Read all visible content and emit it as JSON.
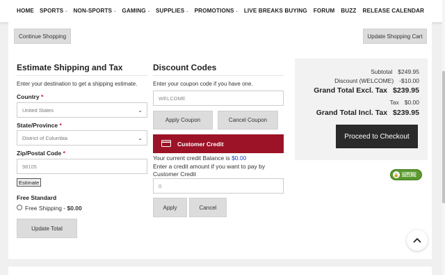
{
  "nav": {
    "left": [
      {
        "label": "HOME",
        "caret": false
      },
      {
        "label": "SPORTS",
        "caret": true
      },
      {
        "label": "NON-SPORTS",
        "caret": true
      },
      {
        "label": "GAMING",
        "caret": true
      },
      {
        "label": "SUPPLIES",
        "caret": true
      },
      {
        "label": "PROMOTIONS",
        "caret": true
      },
      {
        "label": "LIVE BREAKS",
        "caret": true
      }
    ],
    "right": [
      "BUYING",
      "FORUM",
      "BUZZ",
      "RELEASE CALENDAR"
    ]
  },
  "cart_actions": {
    "continue_label": "Continue Shopping",
    "update_label": "Update Shopping Cart"
  },
  "shipping": {
    "title": "Estimate Shipping and Tax",
    "intro": "Enter your destination to get a shipping estimate.",
    "country_label": "Country",
    "country_value": "United States",
    "state_label": "State/Province",
    "state_value": "District of Columbia",
    "zip_label": "Zip/Postal Code",
    "zip_placeholder": "98105",
    "estimate_label": "Estimate",
    "method_title": "Free Standard",
    "method_option": "Free Shipping - ",
    "method_price": "$0.00",
    "update_total_label": "Update Total"
  },
  "discount": {
    "title": "Discount Codes",
    "intro": "Enter your coupon code if you have one.",
    "coupon_placeholder": "WELCOME",
    "apply_label": "Apply Coupon",
    "cancel_label": "Cancel Coupon"
  },
  "credit": {
    "title": "Customer Credit",
    "balance_text": "Your current credit Balance is ",
    "balance_value": "$0.00",
    "instruction_1": "Enter a credit amount if you want to pay by",
    "instruction_2": "Customer Credit",
    "amount_placeholder": "0",
    "apply_label": "Apply",
    "cancel_label": "Cancel"
  },
  "summary": {
    "subtotal_label": "Subtotal",
    "subtotal_value": "$249.95",
    "discount_label": "Discount (WELCOME)",
    "discount_value": "-$10.00",
    "grand_excl_label": "Grand Total Excl. Tax",
    "grand_excl_value": "$239.95",
    "tax_label": "Tax",
    "tax_value": "$0.00",
    "grand_incl_label": "Grand Total Incl. Tax",
    "grand_incl_value": "$239.95",
    "checkout_label": "Proceed to Checkout"
  },
  "badge": {
    "line1": "COMODO",
    "line2": "SECURE"
  },
  "colors": {
    "accent_red": "#9c1226",
    "dark_button": "#2a2a2a",
    "link_blue": "#1a3cc4"
  }
}
